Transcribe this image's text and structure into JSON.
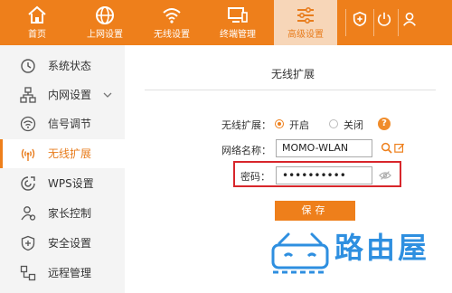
{
  "nav": {
    "items": [
      {
        "label": "首页",
        "icon": "home-icon"
      },
      {
        "label": "上网设置",
        "icon": "globe-icon"
      },
      {
        "label": "无线设置",
        "icon": "wifi-icon"
      },
      {
        "label": "终端管理",
        "icon": "devices-icon"
      },
      {
        "label": "高级设置",
        "icon": "sliders-icon"
      }
    ],
    "right_icons": [
      "shield-plus-icon",
      "power-icon",
      "user-icon"
    ],
    "accent": "#ee7f1b",
    "active_bg": "#f7d6b8"
  },
  "sidebar": {
    "items": [
      {
        "label": "系统状态",
        "icon": "clock-icon"
      },
      {
        "label": "内网设置",
        "icon": "network-icon"
      },
      {
        "label": "信号调节",
        "icon": "signal-icon"
      },
      {
        "label": "无线扩展",
        "icon": "antenna-icon"
      },
      {
        "label": "WPS设置",
        "icon": "wps-icon"
      },
      {
        "label": "家长控制",
        "icon": "parent-icon"
      },
      {
        "label": "安全设置",
        "icon": "shield-icon"
      },
      {
        "label": "远程管理",
        "icon": "remote-icon"
      }
    ],
    "active_index": 3
  },
  "main": {
    "title": "无线扩展",
    "extend_label": "无线扩展：",
    "option_on": "开启",
    "option_off": "关闭",
    "help": "?",
    "ssid_label": "网络名称：",
    "ssid_value": "MOMO-WLAN",
    "password_label": "密码：",
    "password_value": "••••••••••",
    "save_label": "保存",
    "highlight_color": "#d8262b"
  },
  "watermark": {
    "text": "路由屋",
    "color": "#2e8fe0"
  }
}
